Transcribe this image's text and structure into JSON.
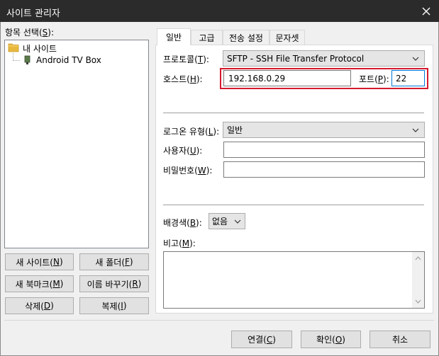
{
  "window": {
    "title": "사이트 관리자"
  },
  "tree": {
    "label": "항목 선택(S):",
    "label_pre": "항목 선택(",
    "label_key": "S",
    "label_post": "):",
    "folder": "내 사이트",
    "site": "Android TV Box"
  },
  "left_buttons": {
    "new_site": {
      "pre": "새 사이트(",
      "key": "N",
      "post": ")"
    },
    "new_folder": {
      "pre": "새 폴더(",
      "key": "F",
      "post": ")"
    },
    "new_bookmark": {
      "pre": "새 북마크(",
      "key": "M",
      "post": ")"
    },
    "rename": {
      "pre": "이름 바꾸기(",
      "key": "R",
      "post": ")"
    },
    "delete": {
      "pre": "삭제(",
      "key": "D",
      "post": ")"
    },
    "copy": {
      "pre": "복제(",
      "key": "I",
      "post": ")"
    }
  },
  "tabs": [
    "일반",
    "고급",
    "전송 설정",
    "문자셋"
  ],
  "general": {
    "protocol": {
      "pre": "프로토콜(",
      "key": "T",
      "post": "):",
      "value": "SFTP - SSH File Transfer Protocol"
    },
    "host": {
      "pre": "호스트(",
      "key": "H",
      "post": "):",
      "value": "192.168.0.29"
    },
    "port": {
      "pre": "포트(",
      "key": "P",
      "post": "):",
      "value": "22"
    },
    "logon_type": {
      "pre": "로그온 유형(",
      "key": "L",
      "post": "):",
      "value": "일반"
    },
    "user": {
      "pre": "사용자(",
      "key": "U",
      "post": "):",
      "value": ""
    },
    "password": {
      "pre": "비밀번호(",
      "key": "W",
      "post": "):",
      "value": ""
    },
    "bg_color": {
      "pre": "배경색(",
      "key": "B",
      "post": "):",
      "value": "없음"
    },
    "comments": {
      "pre": "비고(",
      "key": "M",
      "post": "):",
      "value": ""
    }
  },
  "footer": {
    "connect": {
      "pre": "연결(",
      "key": "C",
      "post": ")"
    },
    "ok": {
      "pre": "확인(",
      "key": "O",
      "post": ")"
    },
    "cancel": "취소"
  },
  "colors": {
    "titlebar": "#2b2b2b",
    "highlight": "#d5192d",
    "folder": "#e8b83d"
  }
}
